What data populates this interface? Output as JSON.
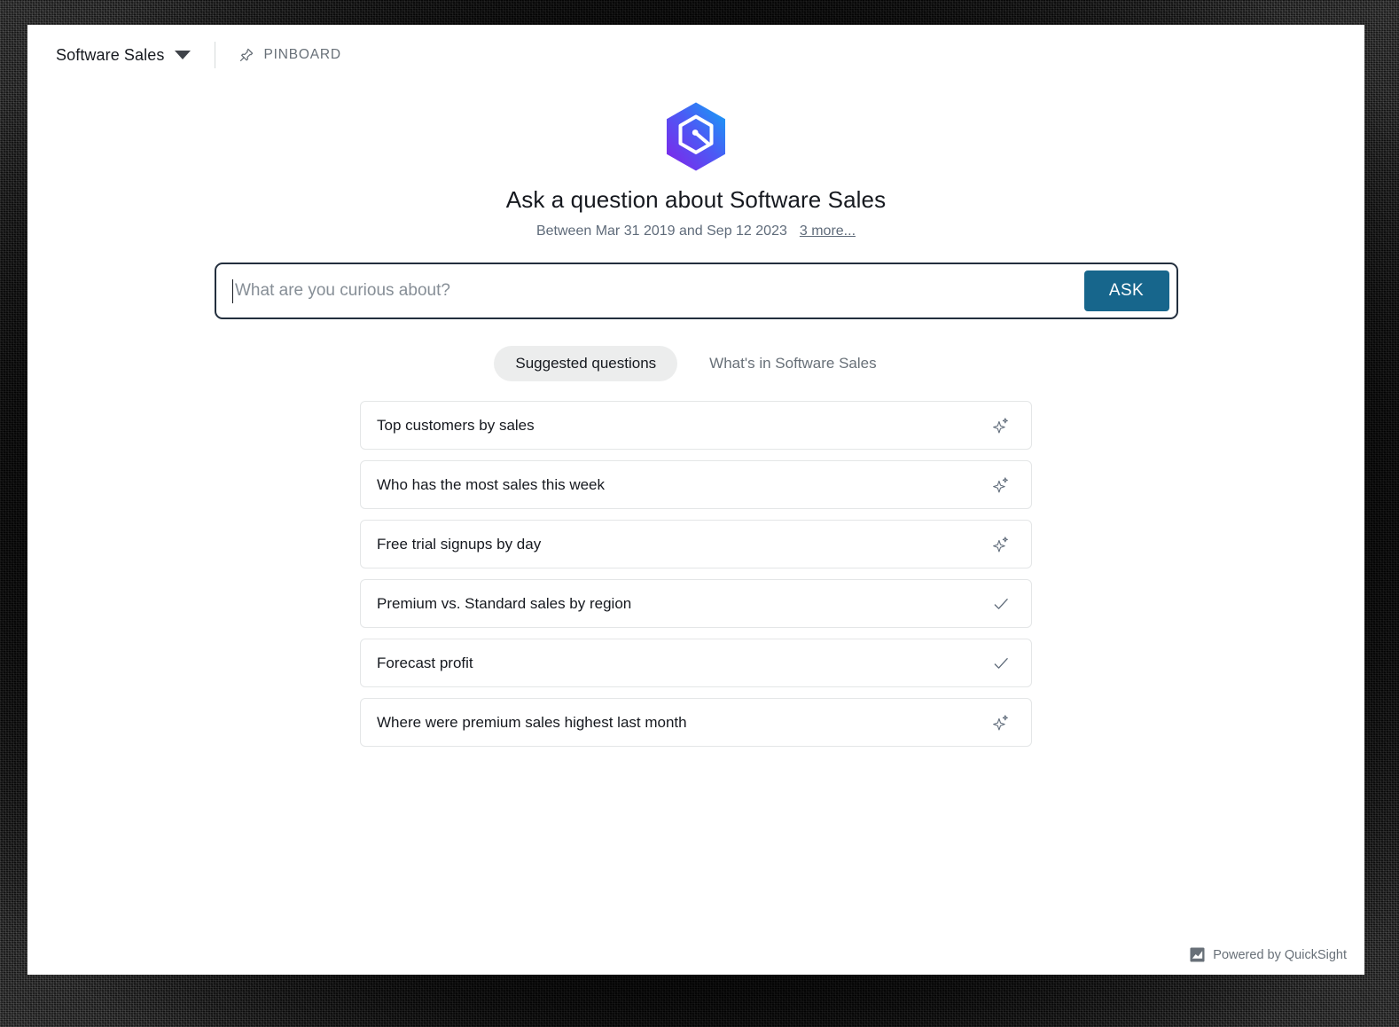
{
  "topbar": {
    "dataset_name": "Software Sales",
    "caret_icon": "chevron-down-icon",
    "pin_icon": "pin-icon",
    "pinboard_label": "PINBOARD"
  },
  "hero": {
    "logo_icon": "quicksight-q-hexagon-logo",
    "logo_colors": {
      "gradient_start": "#19a0f0",
      "gradient_end": "#7a2bf0",
      "inner": "#ffffff"
    },
    "title": "Ask a question about Software Sales",
    "date_range": "Between Mar 31 2019 and Sep 12 2023",
    "more_link": "3 more..."
  },
  "search": {
    "placeholder": "What are you curious about?",
    "value": "",
    "ask_label": "ASK",
    "ask_color": "#17668c",
    "border_color": "#232f3e"
  },
  "tabs": [
    {
      "label": "Suggested questions",
      "active": true
    },
    {
      "label": "What's in Software Sales",
      "active": false
    }
  ],
  "suggestions": [
    {
      "label": "Top customers by sales",
      "icon": "sparkle-icon"
    },
    {
      "label": "Who has the most sales this week",
      "icon": "sparkle-icon"
    },
    {
      "label": "Free trial signups by day",
      "icon": "sparkle-icon"
    },
    {
      "label": "Premium vs. Standard sales by region",
      "icon": "check-icon"
    },
    {
      "label": "Forecast profit",
      "icon": "check-icon"
    },
    {
      "label": "Where were premium sales highest last month",
      "icon": "sparkle-icon"
    }
  ],
  "footer": {
    "mark_icon": "quicksight-chart-mark-icon",
    "text": "Powered by QuickSight"
  }
}
